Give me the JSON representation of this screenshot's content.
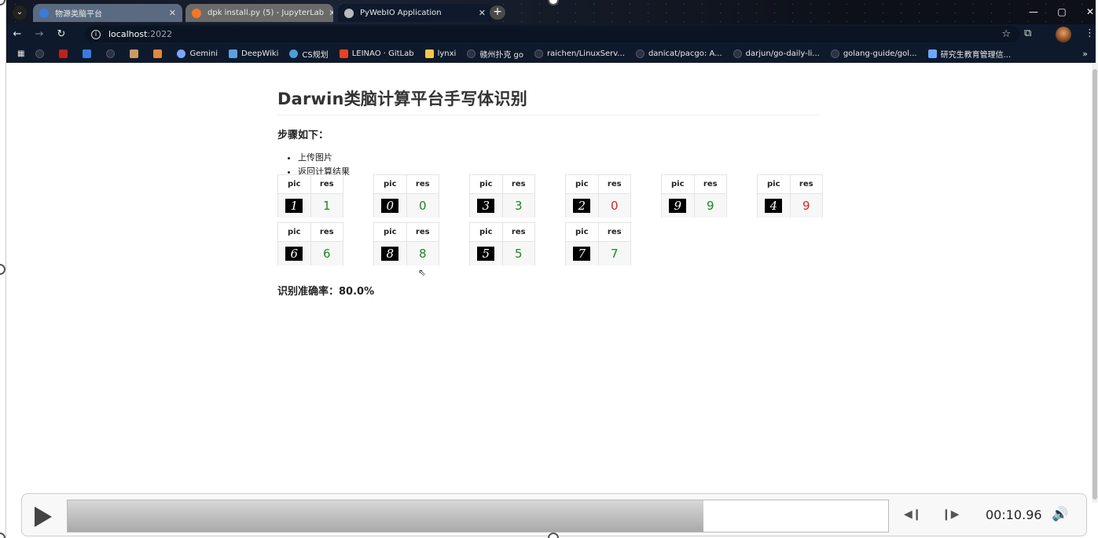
{
  "browser": {
    "tabs": [
      {
        "label": "物源类脑平台",
        "icon_color": "#3d7bd9"
      },
      {
        "label": "dpk install.py (5) - JupyterLab",
        "icon_color": "#f37726"
      },
      {
        "label": "PyWebIO Application",
        "icon_color": "#bbbbbb"
      }
    ],
    "address": {
      "host": "localhost",
      "port": ":2022"
    },
    "bookmarks": [
      "Gemini",
      "DeepWiki",
      "CS规划",
      "LEINAO · GitLab",
      "lynxi",
      "赣州扑克 go",
      "raichen/LinuxServ...",
      "danicat/pacgo: A...",
      "darjun/go-daily-li...",
      "golang-guide/gol...",
      "研究生教育管理信..."
    ],
    "window_buttons": {
      "minimize": "—",
      "maximize": "▢",
      "close": "✕"
    }
  },
  "page": {
    "title": "Darwin类脑计算平台手写体识别",
    "steps_heading": "步骤如下：",
    "steps": [
      "上传图片",
      "返回计算结果"
    ],
    "table_headers": {
      "pic": "pic",
      "res": "res"
    },
    "results": [
      {
        "digit": "1",
        "res": "1",
        "correct": true
      },
      {
        "digit": "0",
        "res": "0",
        "correct": true
      },
      {
        "digit": "3",
        "res": "3",
        "correct": true
      },
      {
        "digit": "2",
        "res": "0",
        "correct": false
      },
      {
        "digit": "9",
        "res": "9",
        "correct": true
      },
      {
        "digit": "4",
        "res": "9",
        "correct": false
      },
      {
        "digit": "6",
        "res": "6",
        "correct": true
      },
      {
        "digit": "8",
        "res": "8",
        "correct": true
      },
      {
        "digit": "5",
        "res": "5",
        "correct": true
      },
      {
        "digit": "7",
        "res": "7",
        "correct": true
      }
    ],
    "accuracy": "识别准确率：80.0%",
    "colors": {
      "correct": "#1a8a1a",
      "wrong": "#e02020"
    }
  },
  "media": {
    "time": "00:10.96",
    "progress": 0.775
  }
}
